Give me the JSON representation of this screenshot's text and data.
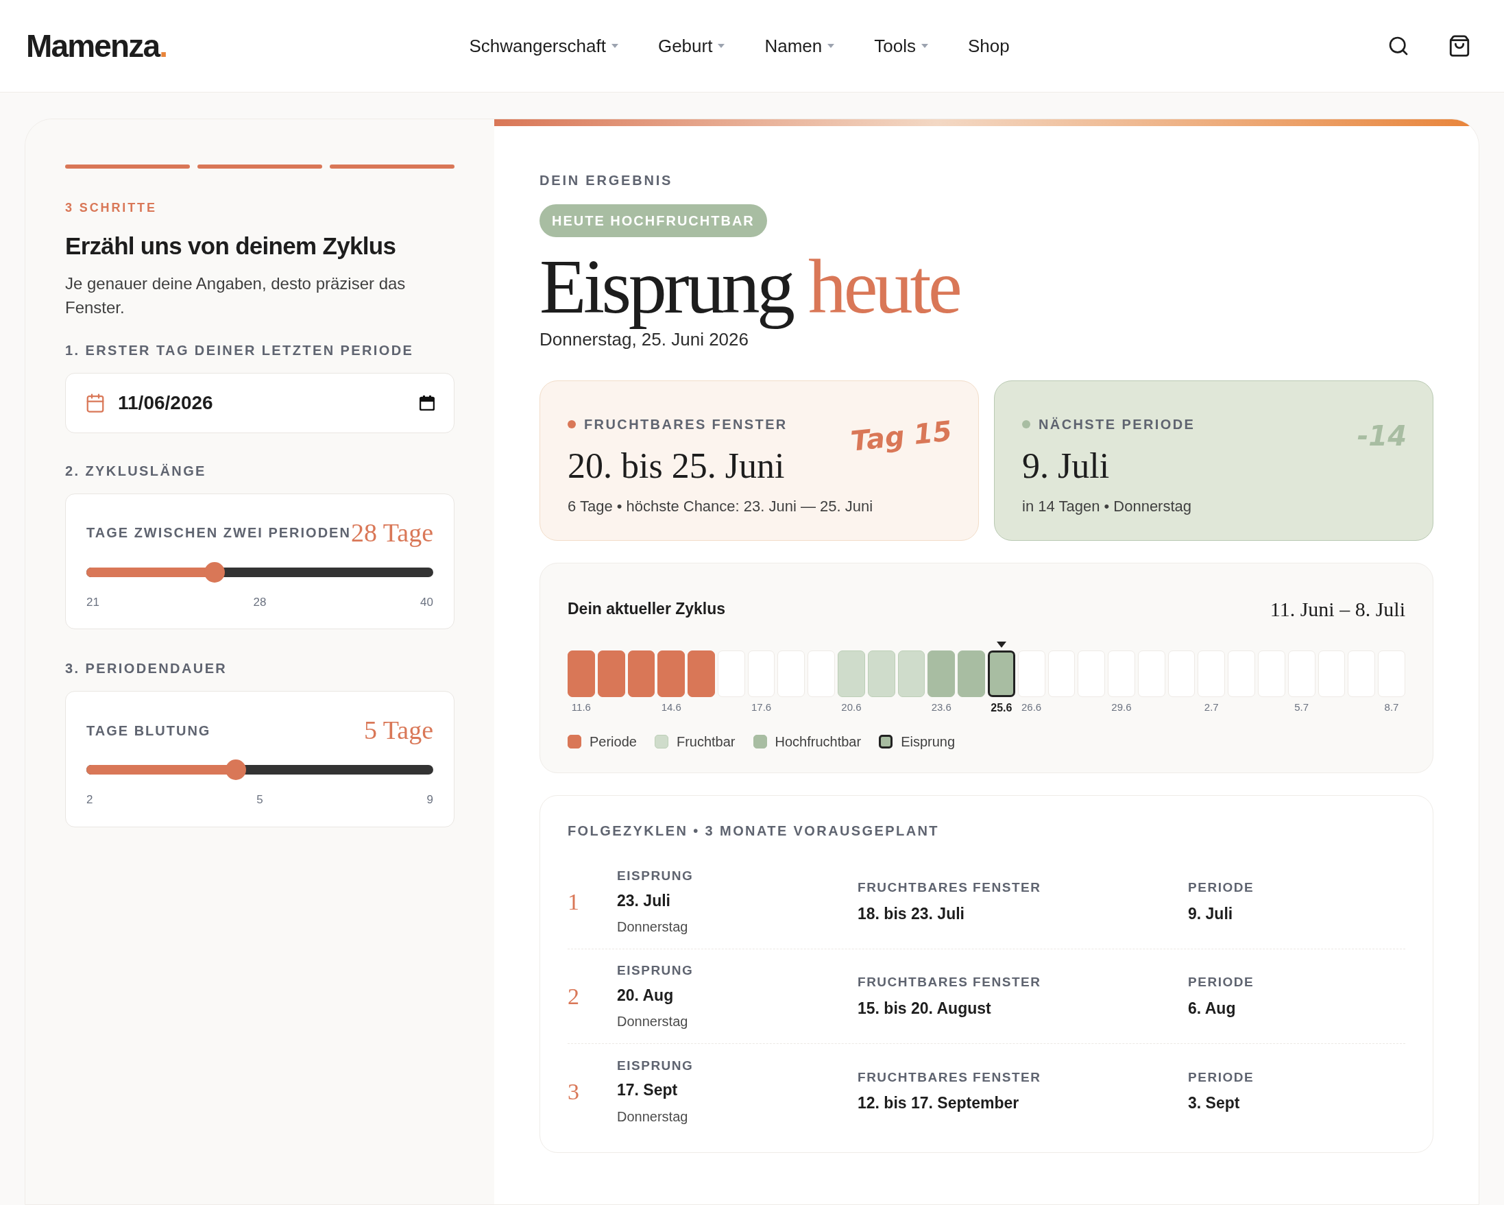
{
  "header": {
    "logo": "Mamenza",
    "logo_dot": ".",
    "nav": [
      {
        "label": "Schwangerschaft",
        "dropdown": true
      },
      {
        "label": "Geburt",
        "dropdown": true
      },
      {
        "label": "Namen",
        "dropdown": true
      },
      {
        "label": "Tools",
        "dropdown": true
      },
      {
        "label": "Shop",
        "dropdown": false
      }
    ]
  },
  "form": {
    "steps": [
      {
        "done": true
      },
      {
        "done": true
      },
      {
        "done": true
      }
    ],
    "eyebrow": "3 SCHRITTE",
    "title": "Erzähl uns von deinem Zyklus",
    "subtitle": "Je genauer deine Angaben, desto präziser das Fenster.",
    "date_label": "1. ERSTER TAG DEINER LETZTEN PERIODE",
    "date_value": "11/06/2026",
    "sliders": [
      {
        "label": "2. ZYKLUSLÄNGE",
        "caption": "TAGE ZWISCHEN ZWEI PERIODEN",
        "value": "28 Tage",
        "level": 0.37,
        "ticks": [
          "21",
          "28",
          "40"
        ]
      },
      {
        "label": "3. PERIODENDAUER",
        "caption": "TAGE BLUTUNG",
        "value": "5 Tage",
        "level": 0.43,
        "ticks": [
          "2",
          "5",
          "9"
        ]
      }
    ]
  },
  "result": {
    "eyebrow": "DEIN ERGEBNIS",
    "badge": "HEUTE HOCHFRUCHTBAR",
    "title_main": "Eisprung",
    "title_accent": "heute",
    "date": "Donnerstag, 25. Juni 2026",
    "cards": [
      {
        "kind": "fertile",
        "color": "#d97757",
        "label": "FRUCHTBARES FENSTER",
        "value": "20. bis 25. Juni",
        "detail": "6 Tage • höchste Chance: 23. Juni — 25. Juni",
        "note": "Tag 15"
      },
      {
        "kind": "period",
        "color": "#a8bda2",
        "label": "NÄCHSTE PERIODE",
        "value": "9. Juli",
        "detail": "in 14 Tagen • Donnerstag",
        "note": "-14"
      }
    ],
    "cycle": {
      "title": "Dein aktueller Zyklus",
      "range": "11. Juni – 8. Juli",
      "days": [
        {
          "kind": "period",
          "label": "11.6"
        },
        {
          "kind": "period"
        },
        {
          "kind": "period"
        },
        {
          "kind": "period",
          "label": "14.6"
        },
        {
          "kind": "period"
        },
        {
          "kind": "none"
        },
        {
          "kind": "none",
          "label": "17.6"
        },
        {
          "kind": "none"
        },
        {
          "kind": "none"
        },
        {
          "kind": "fertile",
          "label": "20.6"
        },
        {
          "kind": "fertile"
        },
        {
          "kind": "fertile"
        },
        {
          "kind": "high",
          "label": "23.6"
        },
        {
          "kind": "high"
        },
        {
          "kind": "ovulation",
          "label": "25.6",
          "selected": true
        },
        {
          "kind": "none",
          "label": "26.6"
        },
        {
          "kind": "none"
        },
        {
          "kind": "none"
        },
        {
          "kind": "none",
          "label": "29.6"
        },
        {
          "kind": "none"
        },
        {
          "kind": "none"
        },
        {
          "kind": "none",
          "label": "2.7"
        },
        {
          "kind": "none"
        },
        {
          "kind": "none"
        },
        {
          "kind": "none",
          "label": "5.7"
        },
        {
          "kind": "none"
        },
        {
          "kind": "none"
        },
        {
          "kind": "none",
          "label": "8.7"
        }
      ],
      "legend": [
        {
          "kind": "period",
          "label": "Periode"
        },
        {
          "kind": "fertile",
          "label": "Fruchtbar"
        },
        {
          "kind": "high",
          "label": "Hochfruchtbar"
        },
        {
          "kind": "ovulation",
          "label": "Eisprung"
        }
      ]
    },
    "upcoming": {
      "title": "FOLGEZYKLEN • 3 MONATE VORAUSGEPLANT",
      "rows": [
        {
          "number": "1",
          "ovulation_label": "EISPRUNG",
          "ovulation": "23. Juli",
          "weekday": "Donnerstag",
          "window_label": "FRUCHTBARES FENSTER",
          "window": "18. bis 23. Juli",
          "period_label": "PERIODE",
          "period": "9. Juli"
        },
        {
          "number": "2",
          "ovulation_label": "EISPRUNG",
          "ovulation": "20. Aug",
          "weekday": "Donnerstag",
          "window_label": "FRUCHTBARES FENSTER",
          "window": "15. bis 20. August",
          "period_label": "PERIODE",
          "period": "6. Aug"
        },
        {
          "number": "3",
          "ovulation_label": "EISPRUNG",
          "ovulation": "17. Sept",
          "weekday": "Donnerstag",
          "window_label": "FRUCHTBARES FENSTER",
          "window": "12. bis 17. September",
          "period_label": "PERIODE",
          "period": "3. Sept"
        }
      ]
    }
  }
}
